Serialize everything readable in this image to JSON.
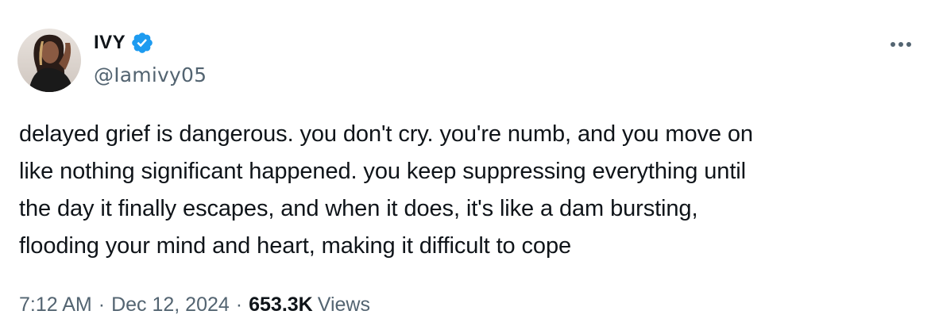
{
  "author": {
    "display_name": "IVY",
    "handle": "@Iamivy05",
    "verified_badge_icon": "verified-badge-icon",
    "badge_color": "#1d9bf0"
  },
  "tweet": {
    "text": "delayed grief is dangerous. you don't cry. you're numb, and you move on\nlike nothing significant happened. you keep suppressing everything until\nthe day it finally escapes, and when it does, it's like a dam bursting,\nflooding your mind and heart, making it difficult to cope"
  },
  "meta": {
    "time": "7:12 AM",
    "separator": "·",
    "date": "Dec 12, 2024",
    "views_count": "653.3K",
    "views_label": "Views"
  },
  "more_menu_icon": "more-horizontal-icon",
  "colors": {
    "text_primary": "#0f1419",
    "text_secondary": "#536471",
    "verified": "#1d9bf0"
  }
}
